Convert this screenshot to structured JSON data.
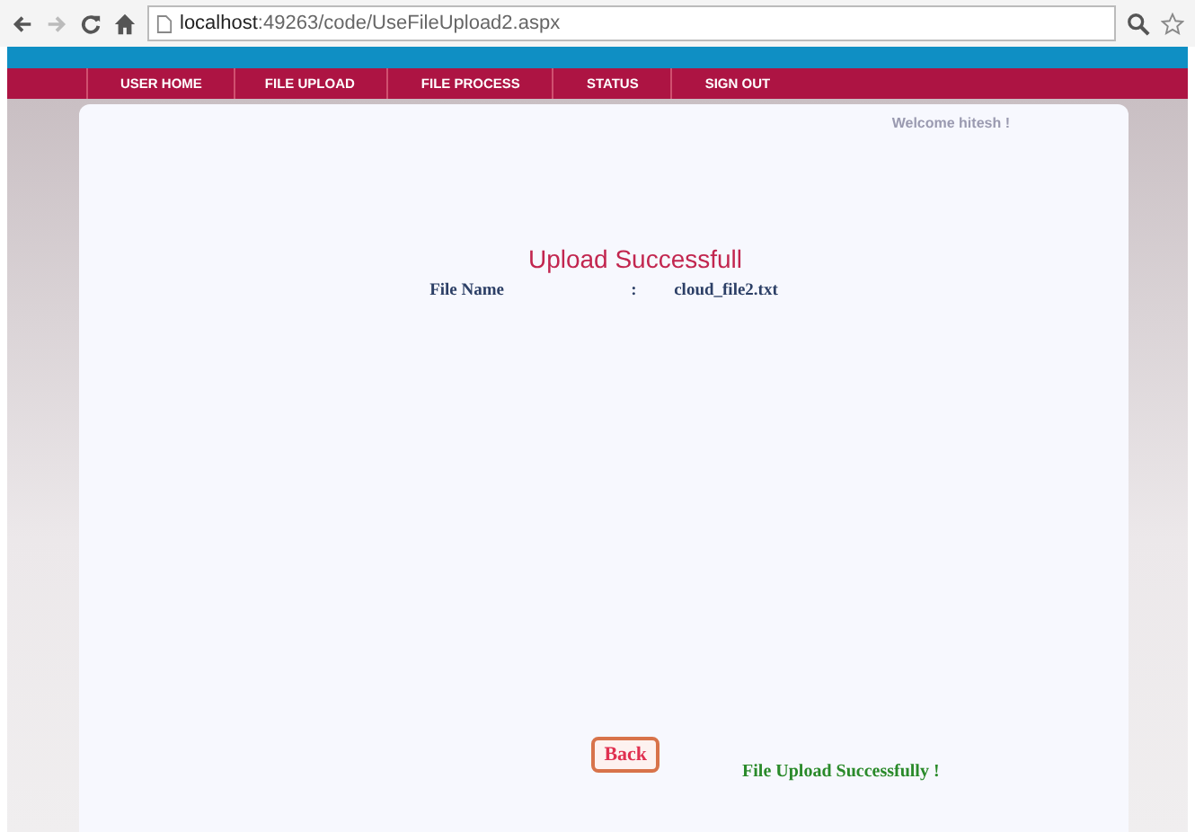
{
  "browser": {
    "address_host": "localhost",
    "address_rest": ":49263/code/UseFileUpload2.aspx"
  },
  "nav": [
    {
      "label": "USER HOME"
    },
    {
      "label": "FILE UPLOAD"
    },
    {
      "label": "FILE PROCESS"
    },
    {
      "label": "STATUS"
    },
    {
      "label": "SIGN OUT"
    }
  ],
  "welcome": "Welcome hitesh !",
  "heading": "Upload Successfull",
  "file_row": {
    "label": "File Name",
    "separator": ":",
    "value": "cloud_file2.txt"
  },
  "back_button": "Back",
  "status_message": "File Upload Successfully !"
}
